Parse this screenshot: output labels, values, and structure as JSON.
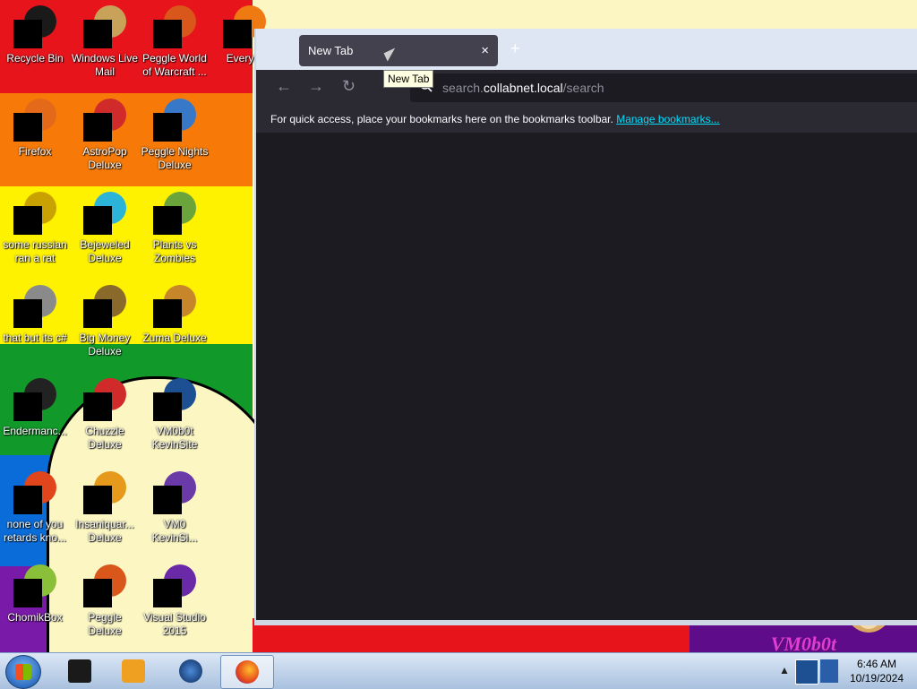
{
  "desktop": {
    "icons": [
      {
        "label": "Recycle Bin",
        "art_color": "#1a1a1a"
      },
      {
        "label": "Windows Live Mail",
        "art_color": "#c9a25a"
      },
      {
        "label": "Peggle World of Warcraft ...",
        "art_color": "#d9571a"
      },
      {
        "label": "Everyth",
        "art_color": "#f07a12"
      },
      {
        "label": "Firefox",
        "art_color": "#e46a19"
      },
      {
        "label": "AstroPop Deluxe",
        "art_color": "#d02a2a"
      },
      {
        "label": "Peggle Nights Deluxe",
        "art_color": "#3878c8"
      },
      {
        "label": "some russian ran a rat",
        "art_color": "#c9a100"
      },
      {
        "label": "Bejeweled Deluxe",
        "art_color": "#2cb3d8"
      },
      {
        "label": "Plants vs Zombies",
        "art_color": "#6aa43a"
      },
      {
        "label": "that but its c#",
        "art_color": "#8a8a8a"
      },
      {
        "label": "Big Money Deluxe",
        "art_color": "#8a6a2a"
      },
      {
        "label": "Zuma Deluxe",
        "art_color": "#c8862a"
      },
      {
        "label": "Endermanc...",
        "art_color": "#222222"
      },
      {
        "label": "Chuzzle Deluxe",
        "art_color": "#d02a2a"
      },
      {
        "label": "VM0b0t KevinSite",
        "art_color": "#1d4f93"
      },
      {
        "label": "none of you retards kno...",
        "art_color": "#e0451c"
      },
      {
        "label": "Insaniquar... Deluxe",
        "art_color": "#e59a1c"
      },
      {
        "label": "VM0 KevinSi...",
        "art_color": "#6a3aa8"
      },
      {
        "label": "ChomikBox",
        "art_color": "#8abf3a"
      },
      {
        "label": "Peggle Deluxe",
        "art_color": "#d9571a"
      },
      {
        "label": "Visual Studio 2015",
        "art_color": "#6a2aa8"
      }
    ],
    "wallpaper_text": "VM0b0t"
  },
  "browser": {
    "tab_title": "New Tab",
    "tab_close": "×",
    "new_tab": "+",
    "tooltip": "New Tab",
    "nav": {
      "back": "←",
      "forward": "→",
      "reload": "↻"
    },
    "url": {
      "prefix": "search.",
      "host": "collabnet.local",
      "path": "/search"
    },
    "bookmarks_message": "For quick access, place your bookmarks here on the bookmarks toolbar.",
    "manage_bookmarks": "Manage bookmarks..."
  },
  "taskbar": {
    "clock_time": "6:46 AM",
    "clock_date": "10/19/2024",
    "tray_chevron": "▲"
  }
}
